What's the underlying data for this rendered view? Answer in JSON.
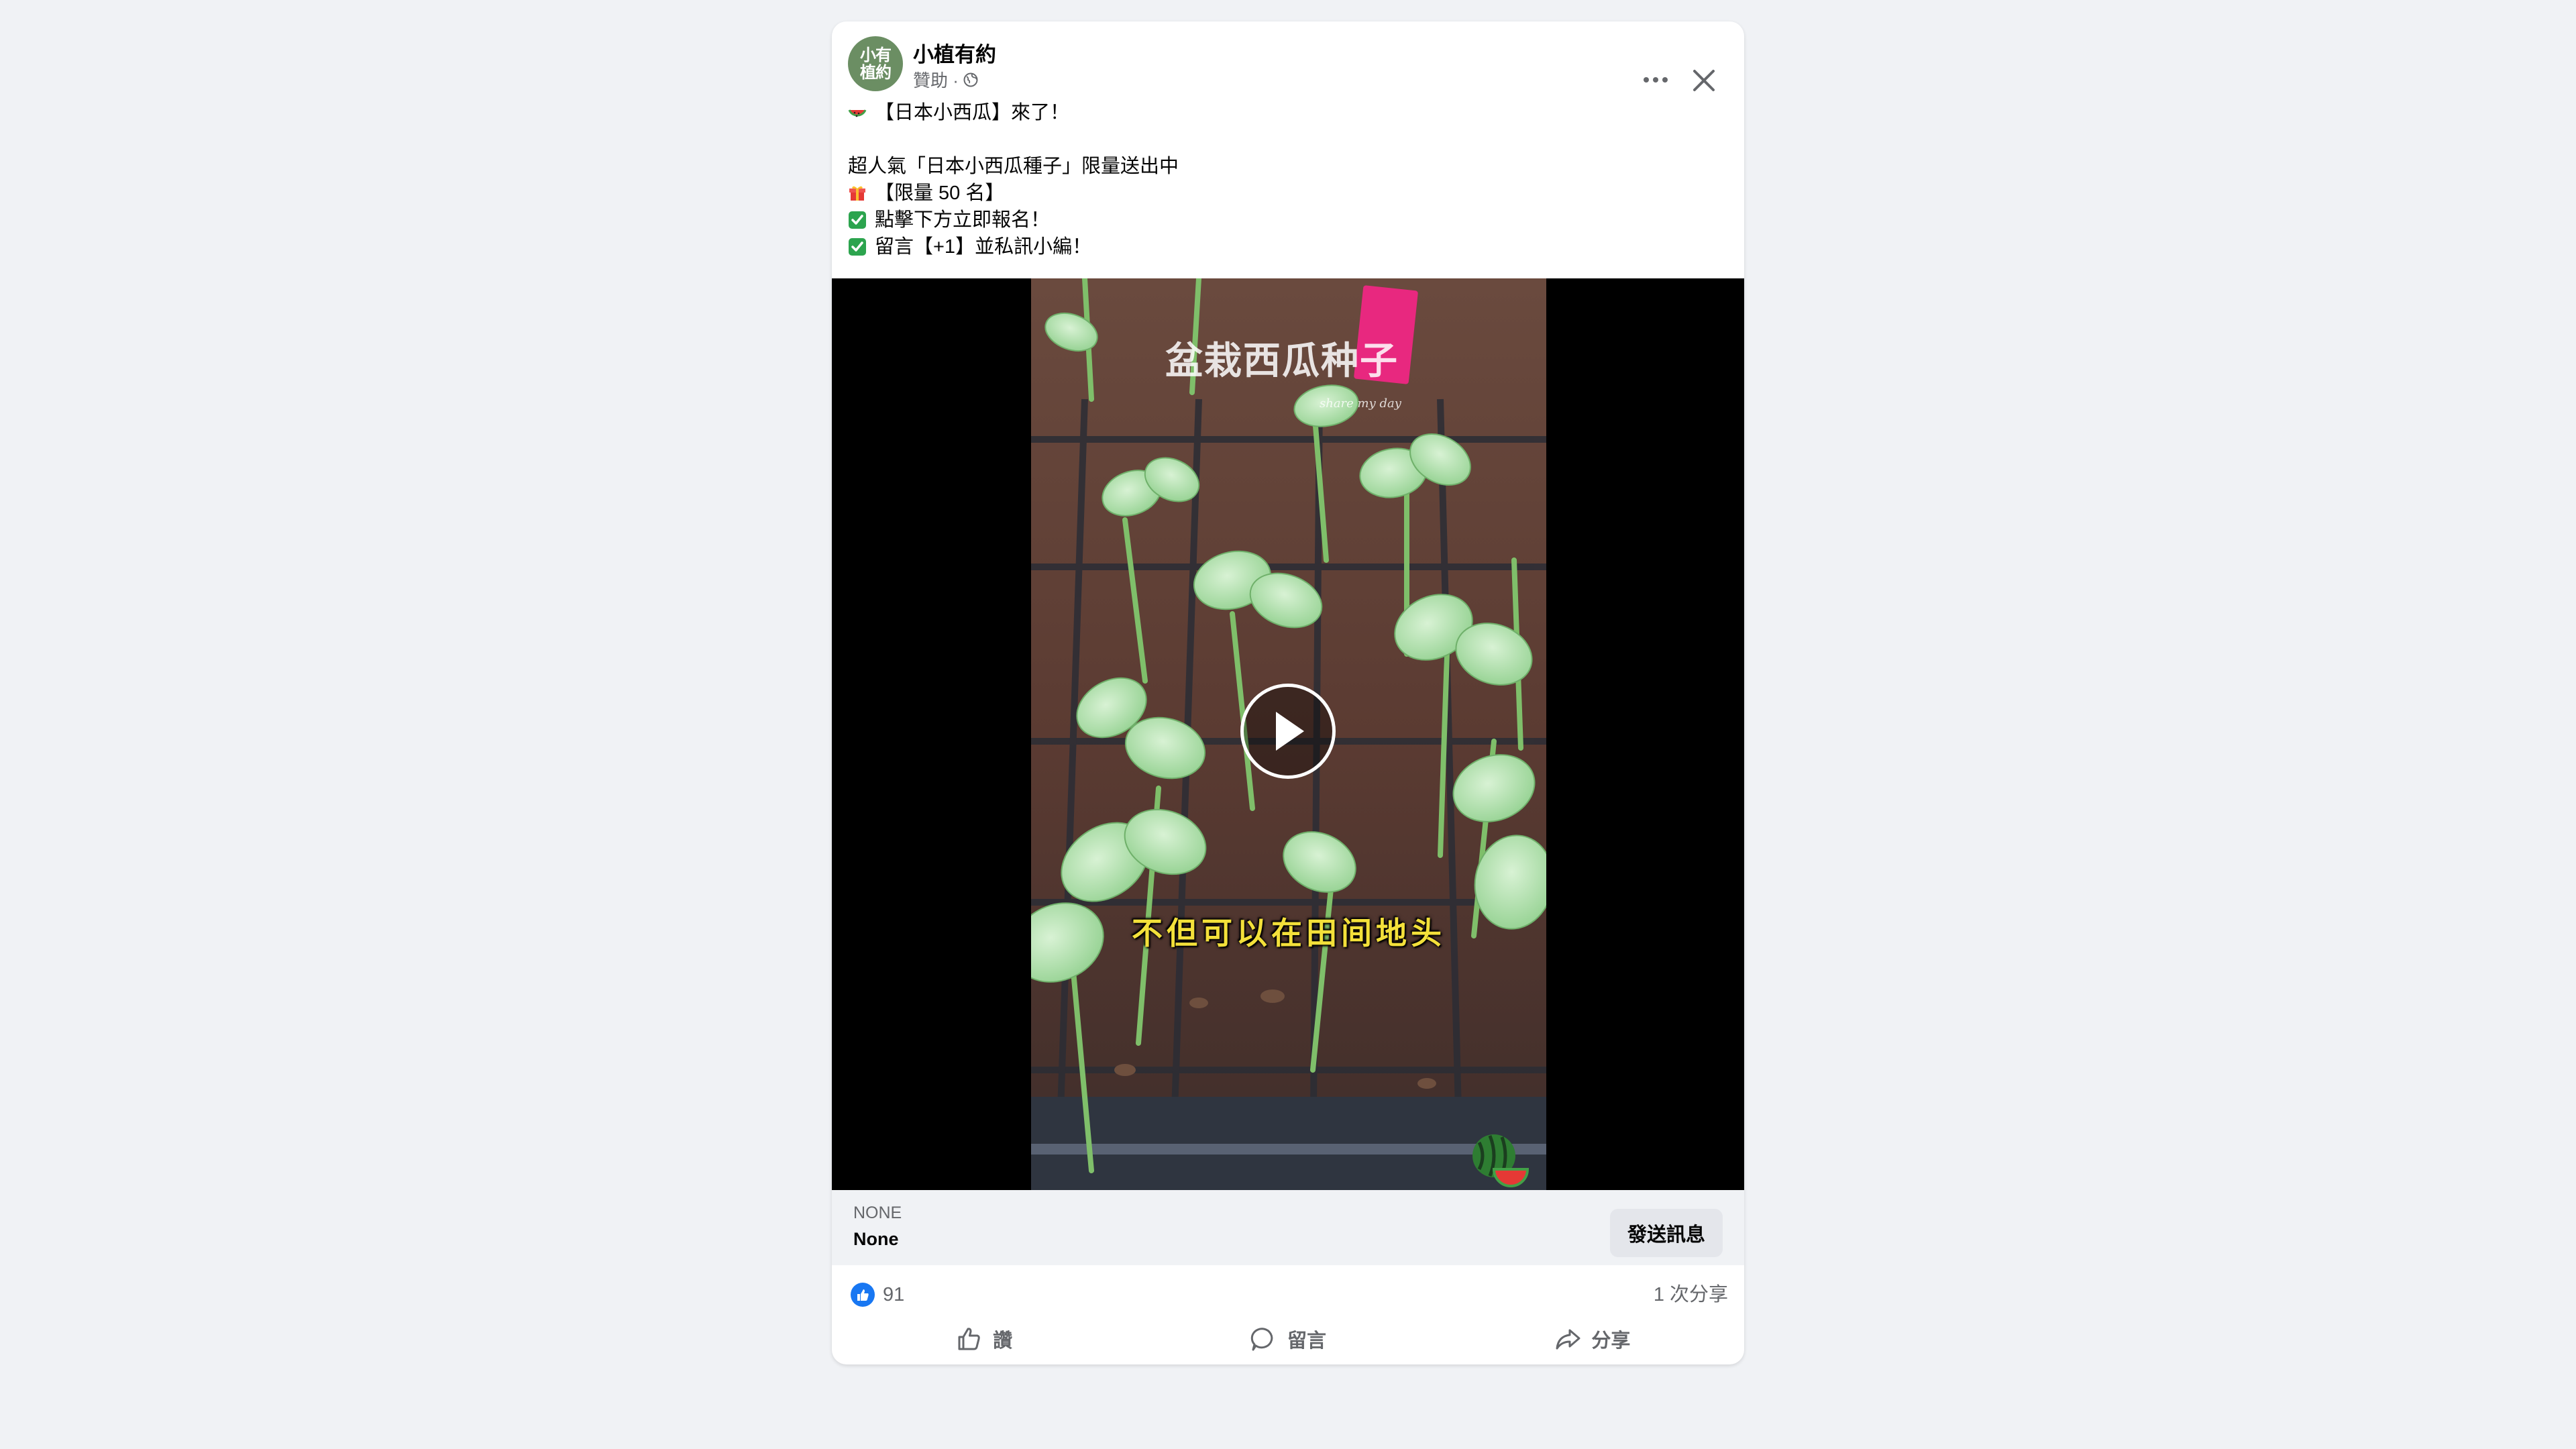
{
  "post": {
    "page_name": "小植有約",
    "sponsored_label": "贊助 ·",
    "avatar_text": "小有植約",
    "text": {
      "line1": "【日本小西瓜】來了！",
      "line2": "超人氣「日本小西瓜種子」限量送出中",
      "line3": "【限量 50 名】",
      "line4": "點擊下方立即報名！",
      "line5": "留言【+1】並私訊小編！"
    }
  },
  "video": {
    "overlay_title": "盆栽西瓜种子",
    "overlay_sub": "share my day",
    "subtitle": "不但可以在田间地头"
  },
  "cta": {
    "caption": "NONE",
    "headline": "None",
    "button_label": "發送訊息"
  },
  "stats": {
    "like_count": "91",
    "share_count": "1 次分享"
  },
  "actions": {
    "like_label": "讚",
    "comment_label": "留言",
    "share_label": "分享"
  },
  "colors": {
    "accent": "#1877f2",
    "background": "#f0f2f5",
    "check_green": "#2ca44e"
  }
}
